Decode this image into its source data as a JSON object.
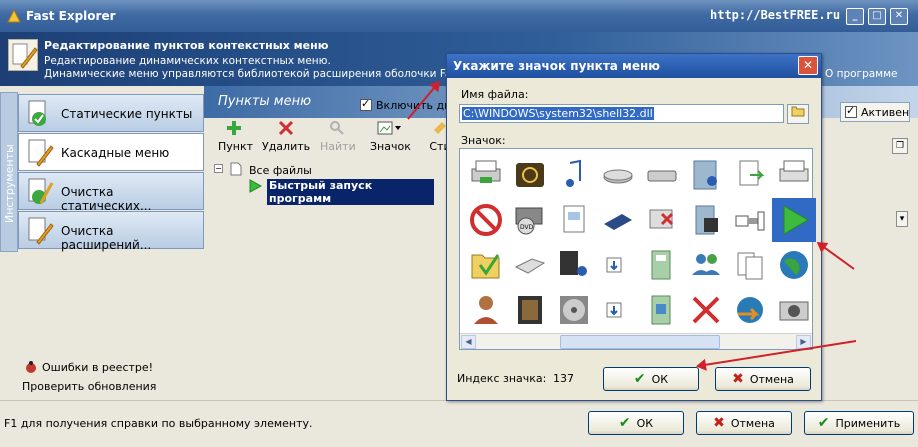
{
  "window": {
    "title": "Fast Explorer",
    "brand": "http://BestFREE.ru",
    "min": "_",
    "max": "□",
    "close": "✕"
  },
  "banner": {
    "title": "Редактирование пунктов контекстных меню",
    "line1": "Редактирование динамических контекстных меню.",
    "line2": "Динамические меню управляются библиотекой расширения оболочки Fast Ex",
    "about": "О программе"
  },
  "sidebar": {
    "vertical_tab": "Инструменты",
    "items": [
      {
        "label": "Статические пункты",
        "icon": "static-items-icon"
      },
      {
        "label": "Каскадные меню",
        "icon": "cascade-menu-icon"
      },
      {
        "label": "Очистка статических...",
        "icon": "clean-static-icon"
      },
      {
        "label": "Очистка расширений...",
        "icon": "clean-extensions-icon"
      }
    ],
    "errors": "Ошибки в реестре!",
    "updates": "Проверить обновления"
  },
  "main": {
    "title": "Пункты меню",
    "enable_label": "Включить дин",
    "active_label": "Активен",
    "toolbar": [
      {
        "label": "Пункт",
        "icon": "add-icon"
      },
      {
        "label": "Удалить",
        "icon": "delete-icon"
      },
      {
        "label": "Найти",
        "icon": "find-icon"
      },
      {
        "label": "Значок",
        "icon": "image-icon"
      },
      {
        "label": "Сти",
        "icon": "style-icon"
      }
    ],
    "tree": {
      "root": "Все файлы",
      "child": "Быстрый запуск программ",
      "expander": "−"
    }
  },
  "dialog": {
    "title": "Укажите значок пункта меню",
    "file_label": "Имя файла:",
    "file_value": "C:\\WINDOWS\\system32\\shell32.dll",
    "icon_label": "Значок:",
    "index_label": "Индекс значка:",
    "index_value": "137",
    "ok": "ОК",
    "cancel": "Отмена",
    "icons": [
      "printer-icon",
      "power-icon",
      "music-note-icon",
      "drive-icon",
      "removable-disk-icon",
      "media-folder-icon",
      "page-arrow-icon",
      "printer2-icon",
      "no-entry-icon",
      "dvd-drive-icon",
      "page-icon",
      "card-icon",
      "delete-page-icon",
      "film-folder-icon",
      "compressed-file-icon",
      "play-icon",
      "folder-check-icon",
      "scanner-icon",
      "film-music-icon",
      "down-arrow-icon",
      "blank-icon",
      "book-icon",
      "users-icon",
      "document-copy-icon",
      "globe-icon",
      "user-icon",
      "film-icon",
      "disc-icon",
      "down-arrow2-icon",
      "blank2-icon",
      "book2-icon",
      "red-x-icon",
      "globe-arrow-icon",
      "camera-icon"
    ],
    "selected_icon": "play-icon"
  },
  "status": {
    "help": "F1 для получения справки по выбранному элементу.",
    "ok": "ОК",
    "cancel": "Отмена",
    "apply": "Применить"
  }
}
